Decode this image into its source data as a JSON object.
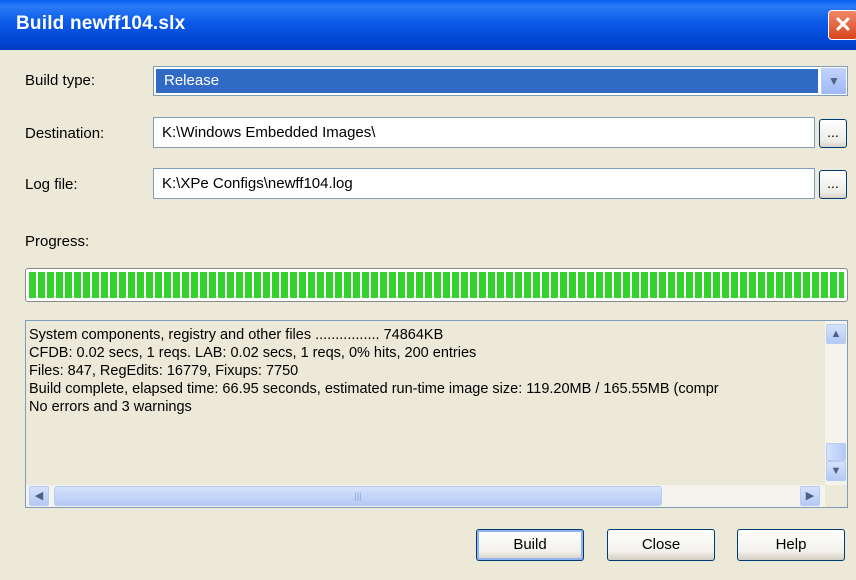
{
  "window": {
    "title": "Build newff104.slx",
    "close_glyph": "✕"
  },
  "build_type": {
    "label": "Build type:",
    "value": "Release"
  },
  "destination": {
    "label": "Destination:",
    "value": "K:\\Windows Embedded Images\\",
    "browse_label": "..."
  },
  "log_file": {
    "label": "Log file:",
    "value": "K:\\XPe Configs\\newff104.log",
    "browse_label": "..."
  },
  "progress": {
    "label": "Progress:",
    "percent": 100
  },
  "log": {
    "lines": [
      "    System components, registry and other files ................  74864KB",
      "CFDB: 0.02 secs, 1 reqs. LAB: 0.02 secs, 1 reqs, 0% hits, 200 entries",
      "Files: 847, RegEdits: 16779, Fixups: 7750",
      "Build complete, elapsed time: 66.95 seconds, estimated run-time image size: 119.20MB / 165.55MB (compr",
      "No errors and 3 warnings"
    ]
  },
  "buttons": {
    "build": "Build",
    "close": "Close",
    "help": "Help"
  },
  "colors": {
    "titlebar": "#0054E3",
    "selection": "#316AC5",
    "progress": "#33D22E",
    "face": "#ECE9D8"
  },
  "icons": {
    "dropdown": "chevron-down-icon",
    "scroll_up": "scroll-up-icon",
    "scroll_down": "scroll-down-icon",
    "scroll_left": "scroll-left-icon",
    "scroll_right": "scroll-right-icon"
  }
}
